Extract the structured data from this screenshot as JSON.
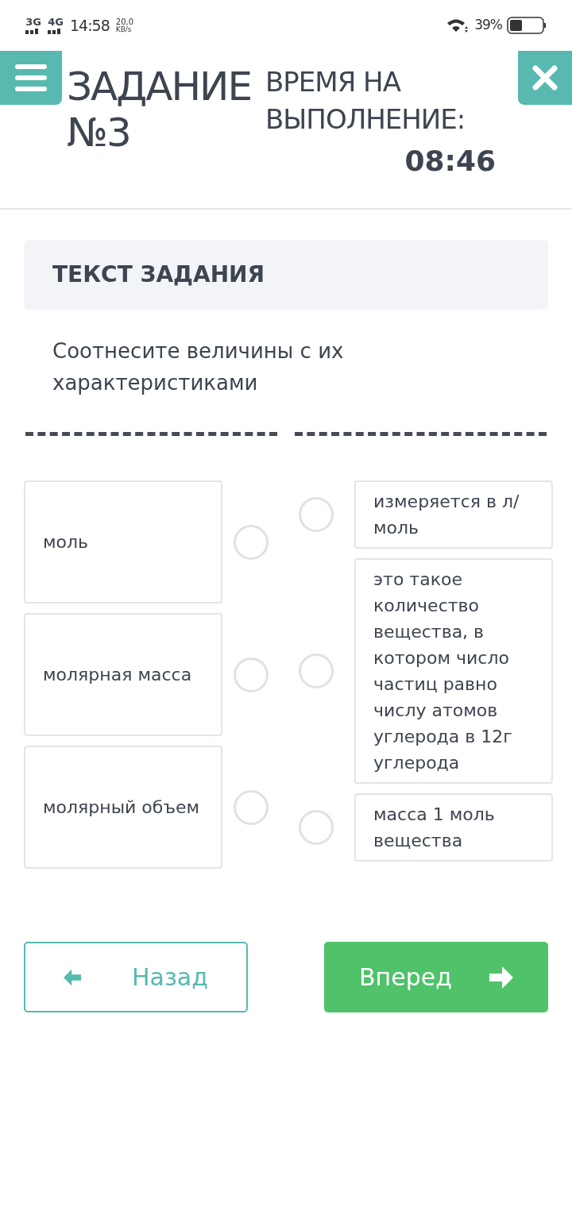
{
  "status_bar": {
    "network_1": "3G",
    "network_2": "4G",
    "time": "14:58",
    "speed_value": "20,0",
    "speed_unit": "KB/s",
    "battery": "39%"
  },
  "header": {
    "title": "ЗАДАНИЕ №3",
    "timer_label": "ВРЕМЯ НА ВЫПОЛНЕНИЕ:",
    "timer": "08:46"
  },
  "task": {
    "heading": "ТЕКСТ ЗАДАНИЯ",
    "text": "Соотнесите величины с их характеристиками"
  },
  "left_items": [
    {
      "text": "моль",
      "selected": false
    },
    {
      "text": "молярная масса",
      "selected": false
    },
    {
      "text": "молярный объем",
      "selected": false
    }
  ],
  "right_items": [
    {
      "text": "измеряется в л/ моль",
      "selected": false
    },
    {
      "text": "это такое количество вещества, в котором число частиц равно числу атомов углерода в 12г углерода",
      "selected": false
    },
    {
      "text": "масса 1 моль вещества",
      "selected": false
    }
  ],
  "buttons": {
    "back": "Назад",
    "next": "Вперед"
  }
}
